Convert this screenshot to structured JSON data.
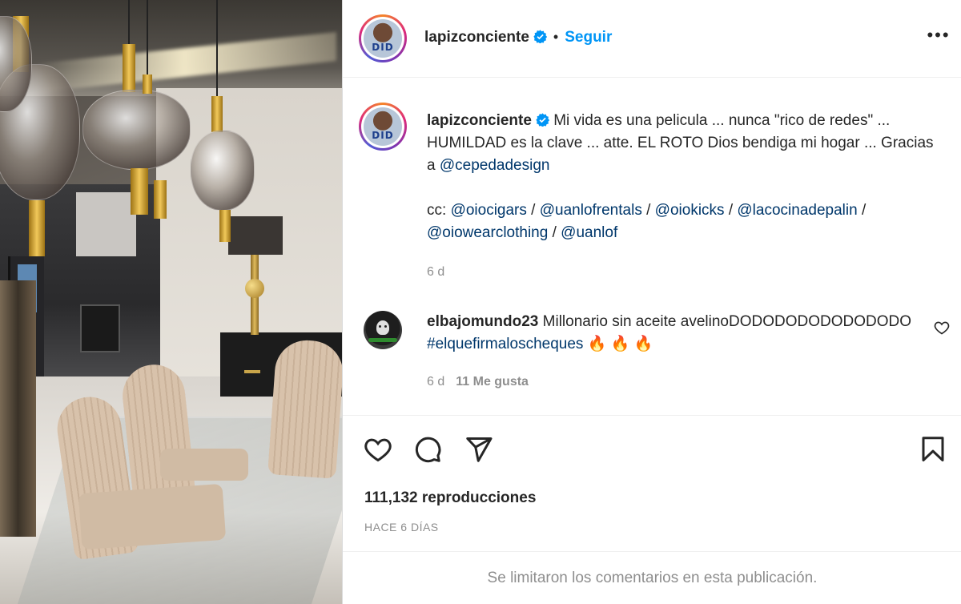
{
  "post": {
    "author": {
      "username": "lapizconciente",
      "avatar_text": "DID",
      "verified": true
    },
    "follow_label": "Seguir",
    "separator": "•",
    "more_label": "•••",
    "caption": {
      "text_1": "Mi vida es una pelicula ... nunca \"rico de redes\" ... HUMILDAD es la clave ... atte. EL ROTO Dios bendiga mi hogar ... Gracias a ",
      "mention_1": "@cepedadesign",
      "cc_label": "cc: ",
      "mentions": [
        "@oiocigars",
        "@uanlofrentals",
        "@oiokicks",
        "@lacocinadepalin",
        "@oiowearclothing",
        "@uanlof"
      ],
      "mention_sep": " / ",
      "time": "6 d"
    },
    "comments": [
      {
        "username": "elbajomundo23",
        "text": "Millonario sin aceite avelinoDODODODODODODODO",
        "hashtag": "#elquefirmaloscheques",
        "emojis": "🔥 🔥 🔥",
        "time": "6 d",
        "likes": "11 Me gusta"
      }
    ],
    "actions": {
      "like_icon": "heart-icon",
      "comment_icon": "comment-icon",
      "share_icon": "paper-plane-icon",
      "save_icon": "bookmark-icon"
    },
    "views": "111,132 reproducciones",
    "date": "HACE 6 DÍAS",
    "comments_limited": "Se limitaron los comentarios en esta publicación."
  },
  "colors": {
    "link": "#0095f6",
    "mention": "#00376b",
    "muted": "#8e8e8e",
    "text": "#262626"
  }
}
